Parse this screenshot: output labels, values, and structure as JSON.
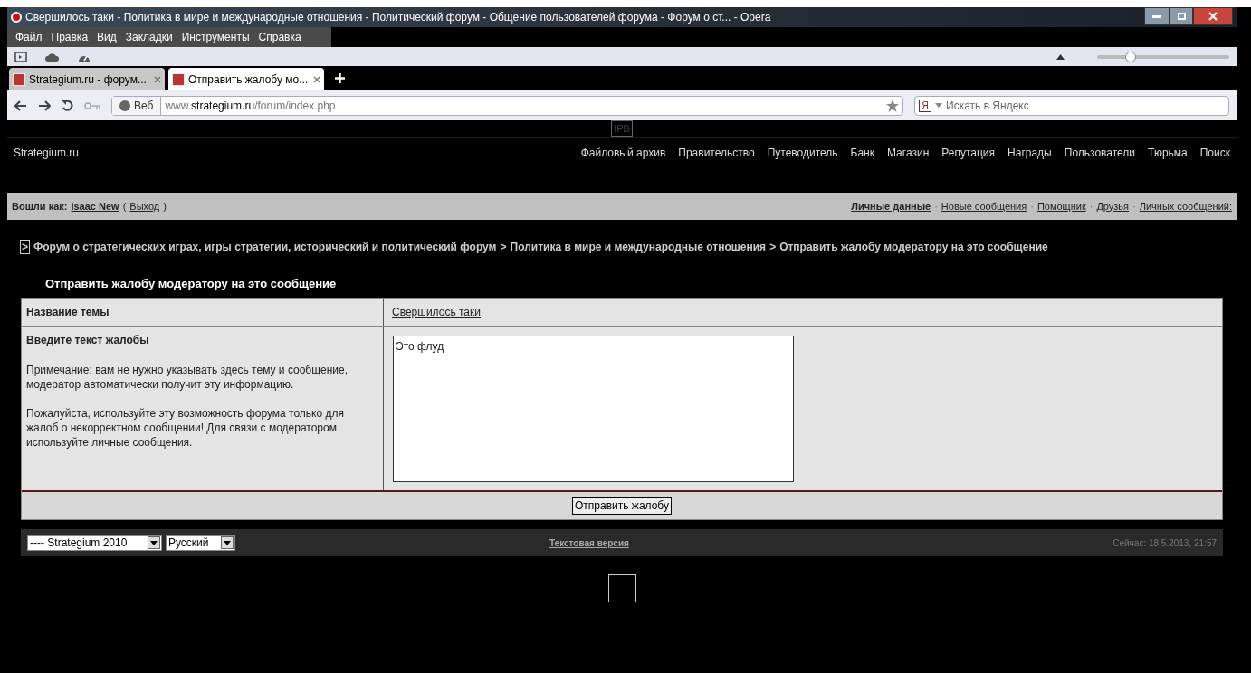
{
  "window": {
    "title": "Свершилось таки - Политика в мире и международные отношения - Политический форум - Общение пользователей форума - Форум о ст... - Opera"
  },
  "menu": [
    "Файл",
    "Правка",
    "Вид",
    "Закладки",
    "Инструменты",
    "Справка"
  ],
  "tabs": [
    {
      "label": "Strategium.ru - форум...",
      "selected": false
    },
    {
      "label": "Отправить жалобу мо...",
      "selected": true
    }
  ],
  "address_bar": {
    "badge": "Веб",
    "url_domain_prefix": "www.",
    "url_domain": "strategium.ru",
    "url_path": "/forum/index.php"
  },
  "zoom": {
    "level": 0.25
  },
  "search": {
    "engine_badge": "Я",
    "placeholder": "Искать в Яндекс"
  },
  "page": {
    "logo_box": "IPB",
    "site_name": "Strategium.ru",
    "nav": [
      "Файловый архив",
      "Правительство",
      "Путеводитель",
      "Банк",
      "Магазин",
      "Репутация",
      "Награды",
      "Пользователи",
      "Тюрьма",
      "Поиск"
    ],
    "user_bar": {
      "label": "Вошли как:",
      "user": "Isaac New",
      "open_paren": "(",
      "logout": "Выход",
      "close_paren": ")",
      "separator": "·",
      "links": [
        {
          "text": "Личные данные",
          "bold": true
        },
        {
          "text": "Новые сообщения",
          "bold": false
        },
        {
          "text": "Помощник",
          "bold": false
        },
        {
          "text": "Друзья",
          "bold": false
        },
        {
          "text": "Личных сообщений:",
          "bold": false
        }
      ]
    },
    "breadcrumb": {
      "marker": ">",
      "items": [
        "Форум о стратегических играх, игры стратегии, исторический и политический форум",
        "Политика в мире и международные отношения",
        "Отправить жалобу модератору на это сообщение"
      ]
    },
    "form": {
      "title": "Отправить жалобу модератору на это сообщение",
      "topic_label": "Название темы",
      "topic_link": "Свершилось таки",
      "text_label": "Введите текст жалобы",
      "notes": [
        "Примечание: вам не нужно указывать здесь тему и сообщение, модератор автоматически получит эту информацию.",
        "Пожалуйста, используйте эту возможность форума только для жалоб о некорректном сообщении! Для связи с модератором используйте личные сообщения."
      ],
      "text_value": "Это флуд",
      "submit": "Отправить жалобу"
    },
    "footer": {
      "skin": "---- Strategium 2010",
      "language": "Русский",
      "text_version": "Текстовая версия",
      "time": "Сейчас: 18.5.2013, 21:57"
    }
  }
}
